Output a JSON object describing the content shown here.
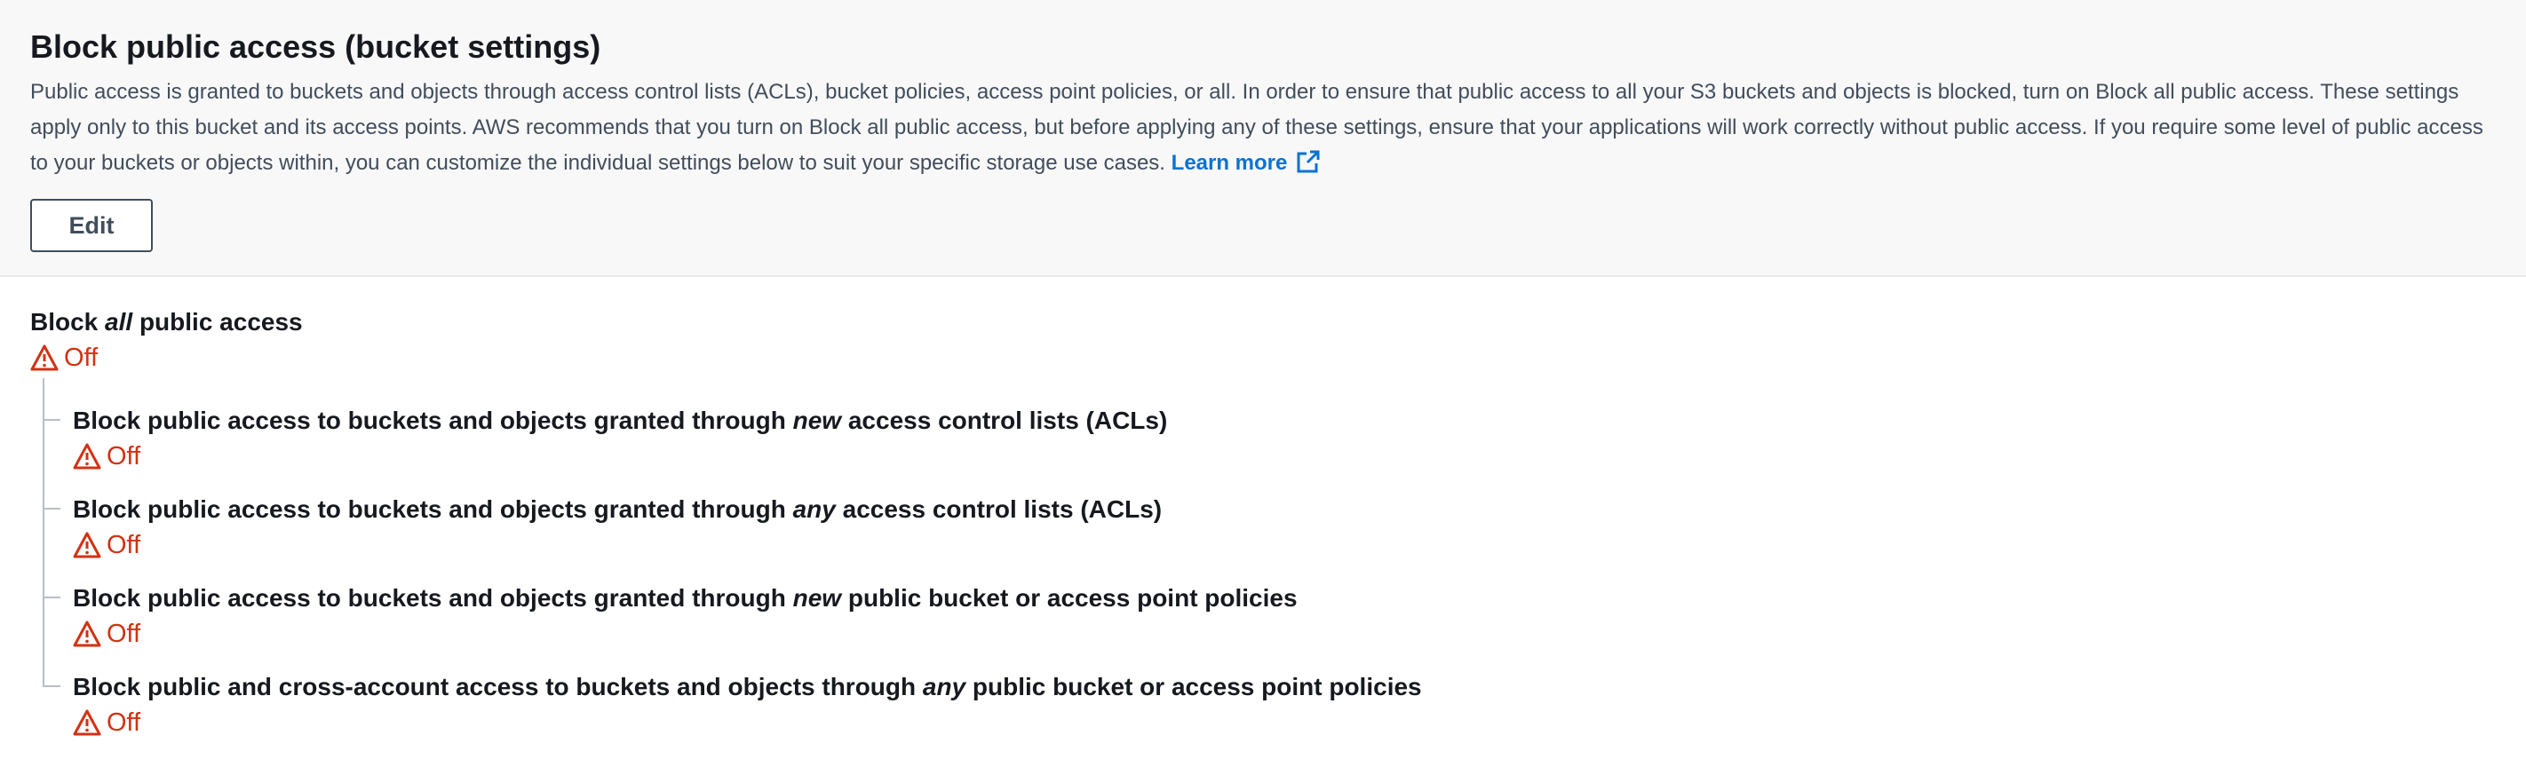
{
  "header": {
    "title": "Block public access (bucket settings)",
    "description": "Public access is granted to buckets and objects through access control lists (ACLs), bucket policies, access point policies, or all. In order to ensure that public access to all your S3 buckets and objects is blocked, turn on Block all public access. These settings apply only to this bucket and its access points. AWS recommends that you turn on Block all public access, but before applying any of these settings, ensure that your applications will work correctly without public access. If you require some level of public access to your buckets or objects within, you can customize the individual settings below to suit your specific storage use cases.",
    "learn_more": "Learn more",
    "edit_label": "Edit"
  },
  "block_all": {
    "prefix": "Block ",
    "emphasis": "all",
    "suffix": " public access",
    "status": "Off"
  },
  "settings": [
    {
      "prefix": "Block public access to buckets and objects granted through ",
      "emphasis": "new",
      "suffix": " access control lists (ACLs)",
      "status": "Off"
    },
    {
      "prefix": "Block public access to buckets and objects granted through ",
      "emphasis": "any",
      "suffix": " access control lists (ACLs)",
      "status": "Off"
    },
    {
      "prefix": "Block public access to buckets and objects granted through ",
      "emphasis": "new",
      "suffix": " public bucket or access point policies",
      "status": "Off"
    },
    {
      "prefix": "Block public and cross-account access to buckets and objects through ",
      "emphasis": "any",
      "suffix": " public bucket or access point policies",
      "status": "Off"
    }
  ],
  "colors": {
    "link": "#0972d3",
    "warning": "#d13212",
    "header_bg": "#f8f8f8"
  },
  "icons": {
    "status": "warning-icon",
    "external": "external-link-icon"
  }
}
